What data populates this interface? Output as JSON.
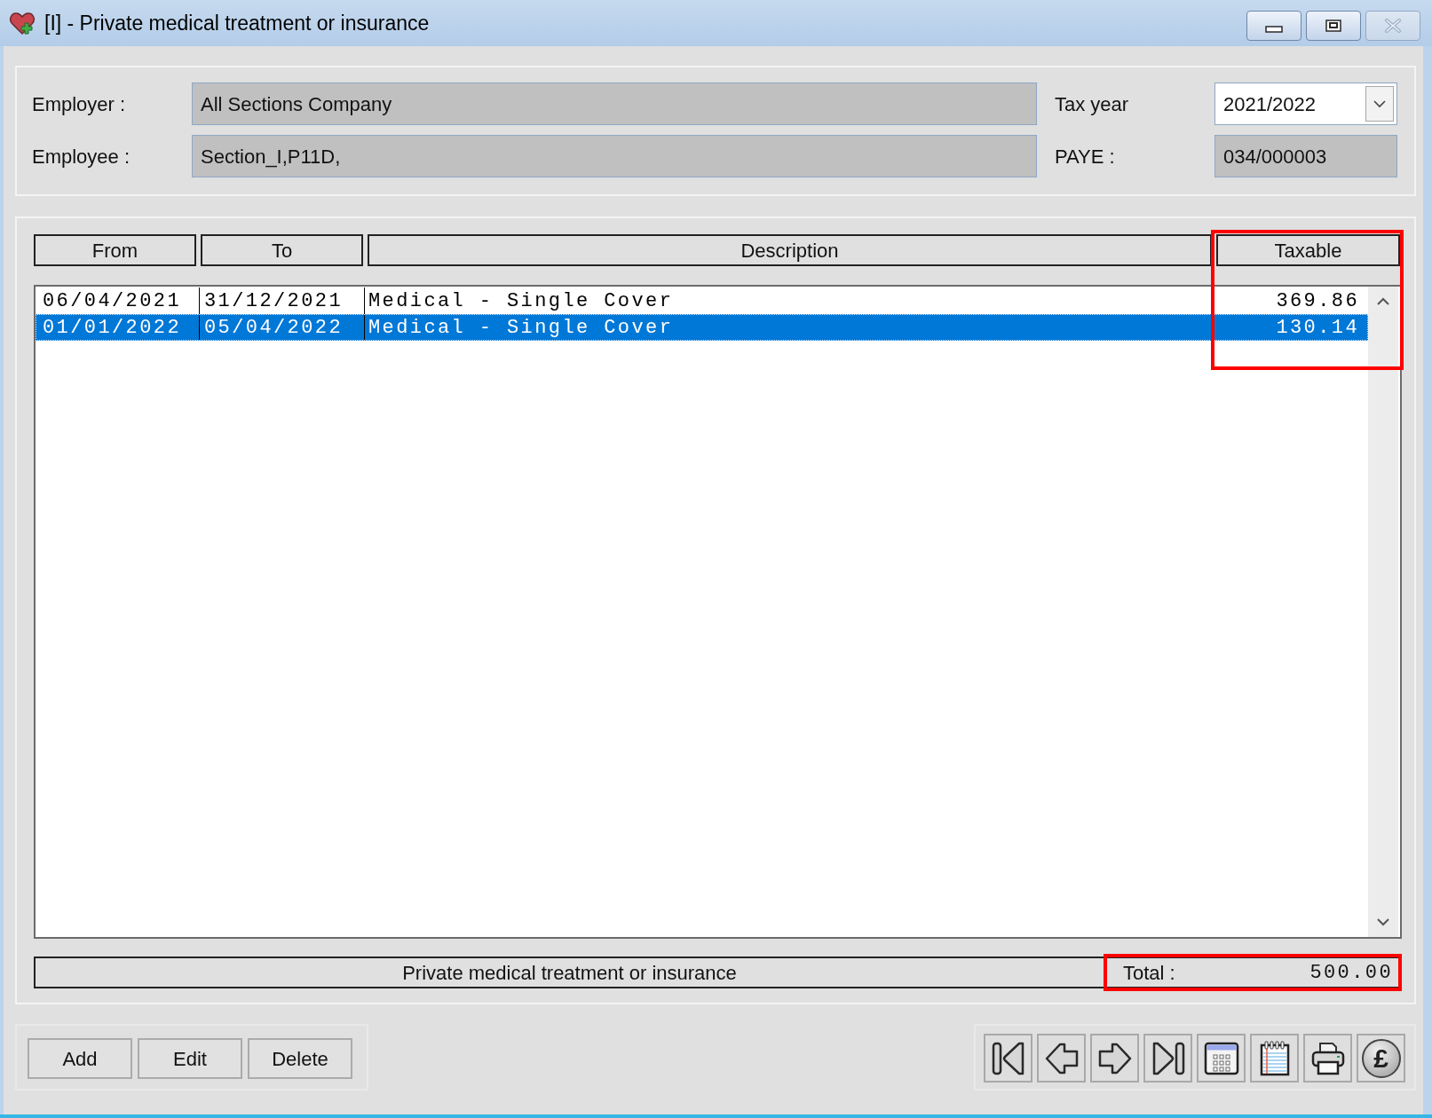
{
  "window": {
    "title": "[I] - Private medical treatment or insurance",
    "controls": [
      {
        "kind": "minimize",
        "disabled": false
      },
      {
        "kind": "maximize",
        "disabled": false
      },
      {
        "kind": "close",
        "disabled": true
      }
    ]
  },
  "header": {
    "fields": [
      {
        "label": "Employer :",
        "value": "All Sections Company",
        "kind": "text"
      },
      {
        "label": "Tax year",
        "value": "2021/2022",
        "kind": "dropdown"
      },
      {
        "label": "Employee :",
        "value": "Section_I,P11D,",
        "kind": "text"
      },
      {
        "label": "PAYE :",
        "value": "034/000003",
        "kind": "text"
      }
    ]
  },
  "table": {
    "columns": [
      {
        "label": "From",
        "highlighted": false
      },
      {
        "label": "To",
        "highlighted": false
      },
      {
        "label": "Description",
        "highlighted": false
      },
      {
        "label": "Taxable",
        "highlighted": true
      }
    ],
    "rows": [
      {
        "cells": [
          "06/04/2021",
          "31/12/2021",
          "Medical - Single Cover",
          "369.86"
        ],
        "selected": false
      },
      {
        "cells": [
          "01/01/2022",
          "05/04/2022",
          "Medical - Single Cover",
          "130.14"
        ],
        "selected": true
      }
    ]
  },
  "footer": {
    "caption": "Private medical treatment or insurance",
    "total_label": "Total :",
    "total_value": "500.00",
    "highlighted": true
  },
  "buttons": [
    {
      "label": "Add"
    },
    {
      "label": "Edit"
    },
    {
      "label": "Delete"
    }
  ],
  "toolbar": [
    {
      "kind": "first"
    },
    {
      "kind": "previous"
    },
    {
      "kind": "next"
    },
    {
      "kind": "last"
    },
    {
      "kind": "calendar"
    },
    {
      "kind": "notepad"
    },
    {
      "kind": "print"
    },
    {
      "kind": "currency",
      "symbol": "£"
    }
  ]
}
